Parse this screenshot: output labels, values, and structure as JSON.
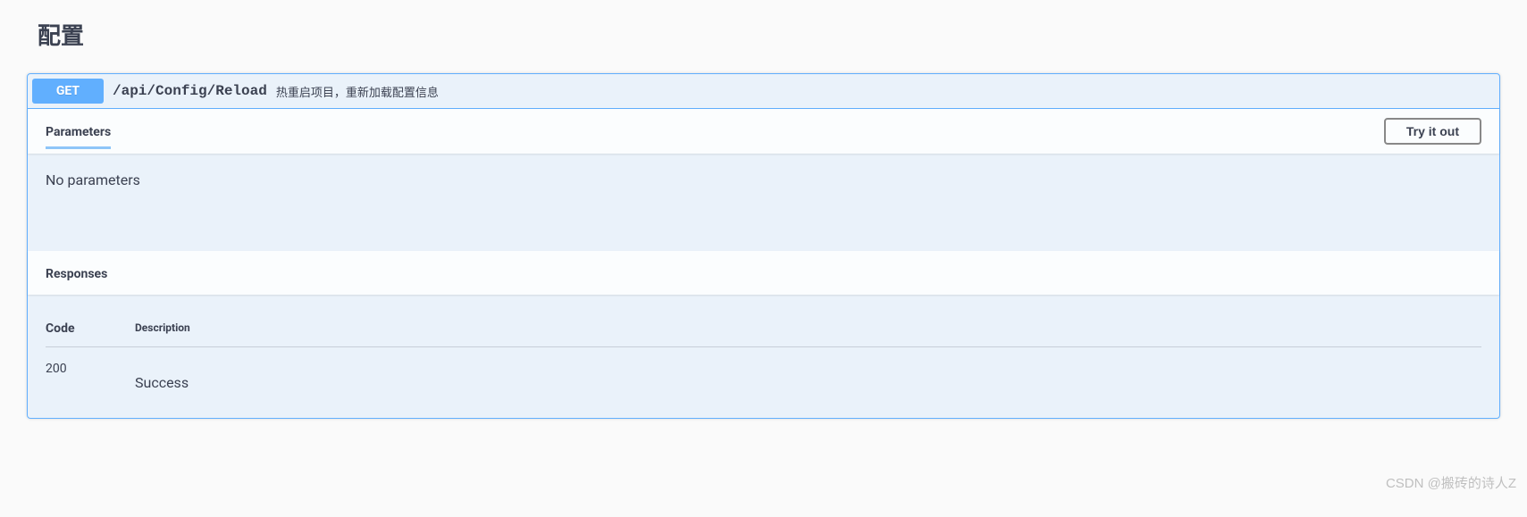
{
  "section": {
    "title": "配置"
  },
  "operation": {
    "method": "GET",
    "path": "/api/Config/Reload",
    "description": "热重启项目，重新加载配置信息"
  },
  "parameters": {
    "heading": "Parameters",
    "try_button": "Try it out",
    "empty_message": "No parameters"
  },
  "responses": {
    "heading": "Responses",
    "columns": {
      "code": "Code",
      "description": "Description"
    },
    "items": [
      {
        "code": "200",
        "description": "Success"
      }
    ]
  },
  "watermark": "CSDN @搬砖的诗人Z"
}
